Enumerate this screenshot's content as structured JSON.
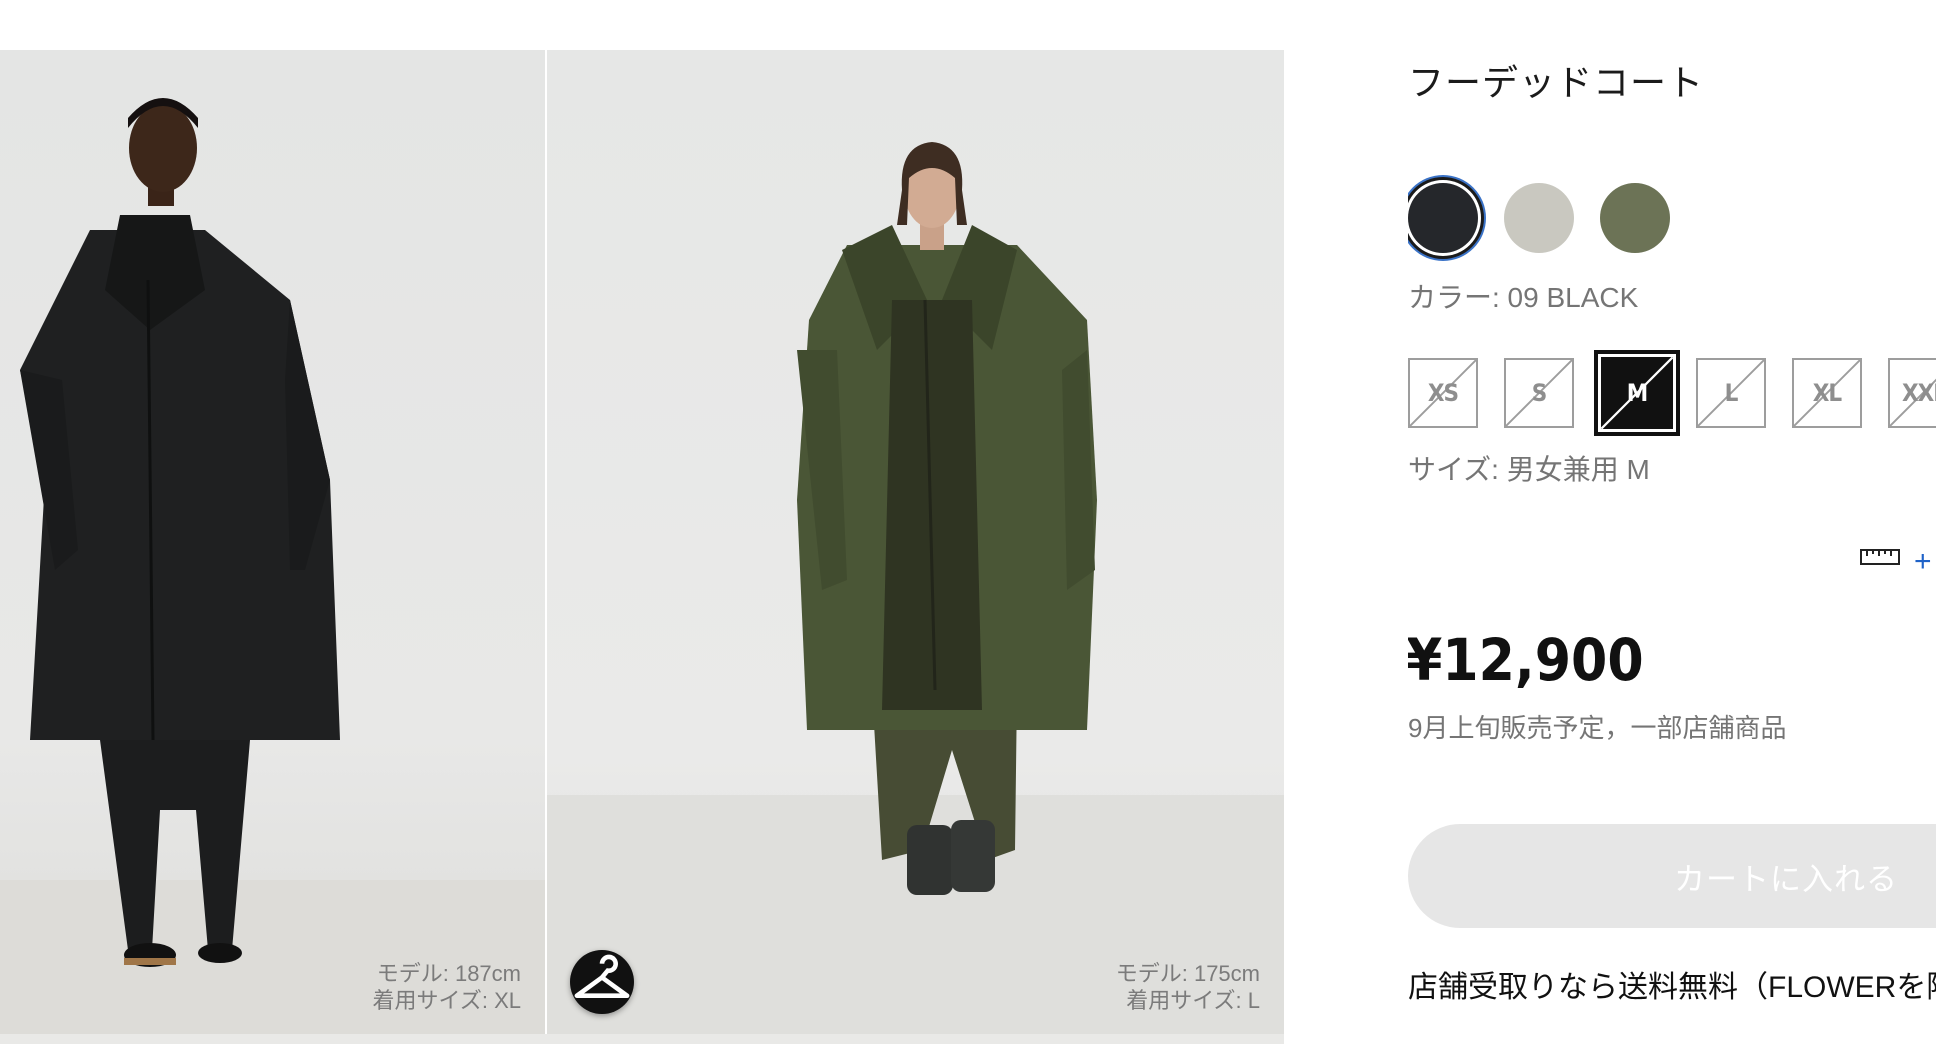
{
  "gallery": {
    "left": {
      "model_height": "モデル: 187cm",
      "size": "着用サイズ: XL",
      "coat_color": "#1f2021"
    },
    "right": {
      "model_height": "モデル: 175cm",
      "size": "着用サイズ: L",
      "coat_color": "#4a5636"
    }
  },
  "product": {
    "title": "フーデッドコート",
    "colors": [
      {
        "name": "09 BLACK",
        "hex": "#25272b",
        "selected": true
      },
      {
        "name": "beige",
        "hex": "#c9c8c0",
        "selected": false
      },
      {
        "name": "olive",
        "hex": "#6c7356",
        "selected": false
      }
    ],
    "color_label": "カラー: 09 BLACK",
    "sizes": [
      {
        "label": "XS",
        "selected": false
      },
      {
        "label": "S",
        "selected": false
      },
      {
        "label": "M",
        "selected": true
      },
      {
        "label": "L",
        "selected": false
      },
      {
        "label": "XL",
        "selected": false
      },
      {
        "label": "XXL",
        "selected": false
      }
    ],
    "size_label": "サイズ: 男女兼用 M",
    "size_guide_label": "+ サ",
    "price": "¥12,900",
    "availability": "9月上旬販売予定，一部店舗商品",
    "add_to_cart": "カートに入れる",
    "shipping_note": "店舗受取りなら送料無料（FLOWERを除"
  },
  "icons": {
    "hanger": "hanger-icon",
    "ruler": "ruler-icon"
  },
  "accent": {
    "link": "#1f62c8",
    "focus_ring": "#3b73c7"
  }
}
